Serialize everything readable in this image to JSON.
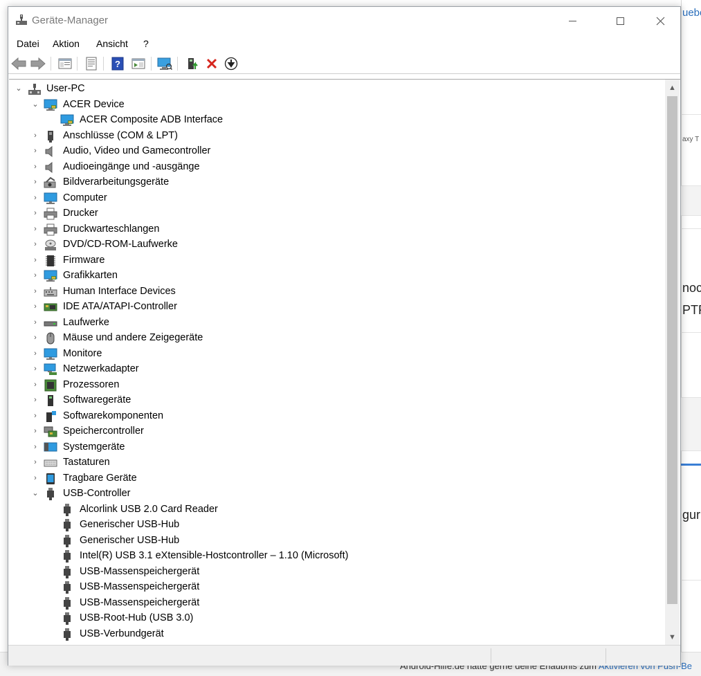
{
  "background": {
    "fragments": [
      "uebe",
      "axy T",
      "noc",
      "PTF",
      "gur"
    ],
    "bottom_text": "Android-Hilfe.de hätte gerne deine Erlaubnis zum ",
    "bottom_link": "Aktivieren von Push-Be"
  },
  "window": {
    "title": "Geräte-Manager",
    "controls": {
      "minimize": "Minimieren",
      "maximize": "Maximieren",
      "close": "Schließen"
    }
  },
  "menu": [
    "Datei",
    "Aktion",
    "Ansicht",
    "?"
  ],
  "toolbar": [
    "back-icon",
    "forward-icon",
    "tree-view-icon",
    "properties-icon",
    "help-icon",
    "action-pane-icon",
    "monitor-icon",
    "update-driver-icon",
    "uninstall-icon",
    "download-icon"
  ],
  "tree": {
    "root": "User-PC",
    "items": [
      {
        "label": "ACER Device",
        "level": 1,
        "expanded": true,
        "icon": "monitor-icon"
      },
      {
        "label": "ACER Composite ADB Interface",
        "level": 2,
        "icon": "monitor-icon"
      },
      {
        "label": "Anschlüsse (COM & LPT)",
        "level": 1,
        "icon": "port-icon"
      },
      {
        "label": "Audio, Video und Gamecontroller",
        "level": 1,
        "icon": "speaker-icon"
      },
      {
        "label": "Audioeingänge und -ausgänge",
        "level": 1,
        "icon": "speaker-icon"
      },
      {
        "label": "Bildverarbeitungsgeräte",
        "level": 1,
        "icon": "camera-icon"
      },
      {
        "label": "Computer",
        "level": 1,
        "icon": "computer-icon"
      },
      {
        "label": "Drucker",
        "level": 1,
        "icon": "printer-icon"
      },
      {
        "label": "Druckwarteschlangen",
        "level": 1,
        "icon": "printer-icon"
      },
      {
        "label": "DVD/CD-ROM-Laufwerke",
        "level": 1,
        "icon": "disc-icon"
      },
      {
        "label": "Firmware",
        "level": 1,
        "icon": "chip-icon"
      },
      {
        "label": "Grafikkarten",
        "level": 1,
        "icon": "monitor-icon"
      },
      {
        "label": "Human Interface Devices",
        "level": 1,
        "icon": "hid-icon"
      },
      {
        "label": "IDE ATA/ATAPI-Controller",
        "level": 1,
        "icon": "controller-icon"
      },
      {
        "label": "Laufwerke",
        "level": 1,
        "icon": "drive-icon"
      },
      {
        "label": "Mäuse und andere Zeigegeräte",
        "level": 1,
        "icon": "mouse-icon"
      },
      {
        "label": "Monitore",
        "level": 1,
        "icon": "computer-icon"
      },
      {
        "label": "Netzwerkadapter",
        "level": 1,
        "icon": "network-icon"
      },
      {
        "label": "Prozessoren",
        "level": 1,
        "icon": "cpu-icon"
      },
      {
        "label": "Softwaregeräte",
        "level": 1,
        "icon": "software-device-icon"
      },
      {
        "label": "Softwarekomponenten",
        "level": 1,
        "icon": "software-component-icon"
      },
      {
        "label": "Speichercontroller",
        "level": 1,
        "icon": "storage-controller-icon"
      },
      {
        "label": "Systemgeräte",
        "level": 1,
        "icon": "system-device-icon"
      },
      {
        "label": "Tastaturen",
        "level": 1,
        "icon": "keyboard-icon"
      },
      {
        "label": "Tragbare Geräte",
        "level": 1,
        "icon": "portable-device-icon"
      },
      {
        "label": "USB-Controller",
        "level": 1,
        "expanded": true,
        "icon": "usb-icon"
      },
      {
        "label": "Alcorlink USB 2.0 Card Reader",
        "level": 2,
        "icon": "usb-icon"
      },
      {
        "label": "Generischer USB-Hub",
        "level": 2,
        "icon": "usb-icon"
      },
      {
        "label": "Generischer USB-Hub",
        "level": 2,
        "icon": "usb-icon"
      },
      {
        "label": "Intel(R) USB 3.1 eXtensible-Hostcontroller – 1.10 (Microsoft)",
        "level": 2,
        "icon": "usb-icon"
      },
      {
        "label": "USB-Massenspeichergerät",
        "level": 2,
        "icon": "usb-icon"
      },
      {
        "label": "USB-Massenspeichergerät",
        "level": 2,
        "icon": "usb-icon"
      },
      {
        "label": "USB-Massenspeichergerät",
        "level": 2,
        "icon": "usb-icon"
      },
      {
        "label": "USB-Root-Hub (USB 3.0)",
        "level": 2,
        "icon": "usb-icon"
      },
      {
        "label": "USB-Verbundgerät",
        "level": 2,
        "icon": "usb-icon"
      },
      {
        "label": "",
        "level": 2,
        "icon": "usb-icon"
      }
    ]
  },
  "colors": {
    "accent": "#2a6ebb",
    "scroll_thumb": "#c2c2c2"
  }
}
